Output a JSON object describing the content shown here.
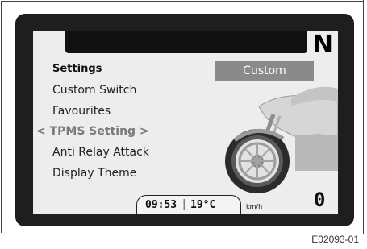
{
  "gear": "N",
  "menu": {
    "title": "Settings",
    "items": [
      {
        "label": "Custom Switch"
      },
      {
        "label": "Favourites"
      },
      {
        "label": "< TPMS Setting >"
      },
      {
        "label": "Anti Relay Attack"
      },
      {
        "label": "Display Theme"
      }
    ],
    "selected_index": 2
  },
  "mode_badge": "Custom",
  "status": {
    "time": "09:53",
    "separator": "|",
    "temperature": "19°C",
    "speed_unit": "km/h",
    "speed": "0"
  },
  "figure_code": "E02093-01",
  "colors": {
    "bezel": "#1e1e1e",
    "screen_bg": "#ededed",
    "badge_bg": "#8a8a8a",
    "selected_text": "#7a7a7a"
  }
}
